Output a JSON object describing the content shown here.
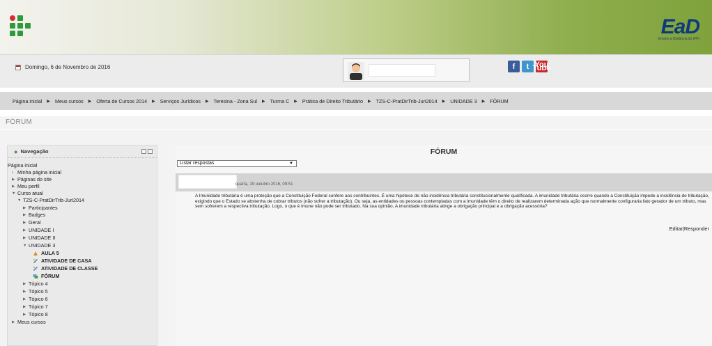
{
  "header": {
    "brand_ead": "EaD",
    "brand_ead_tagline": "Ensino a Distância do IFPI"
  },
  "infobar": {
    "date": "Domingo, 6 de Novembro de 2016"
  },
  "breadcrumb": [
    "Página inicial",
    "Meus cursos",
    "Oferta de Cursos 2014",
    "Serviços Jurídicos",
    "Teresina - Zona Sul",
    "Turma C",
    "Prática de Direito Tributário",
    "TZS-C-PratDirTrib-Juri2014",
    "UNIDADE 3",
    "FÓRUM"
  ],
  "page_heading": "FÓRUM",
  "navigation": {
    "title": "Navegação",
    "items": [
      "Página inicial",
      "Minha página inicial",
      "Páginas do site",
      "Meu perfil",
      "Curso atual",
      "TZS-C-PratDirTrib-Juri2014",
      "Participantes",
      "Badges",
      "Geral",
      "UNIDADE I",
      "UNIDADE II",
      "UNIDADE 3",
      "AULA 5",
      "ATIVIDADE DE CASA",
      "ATIVIDADE DE CLASSE",
      "FÓRUM",
      "Tópico 4",
      "Tópico 5",
      "Tópico 6",
      "Tópico 7",
      "Tópico 8",
      "Meus cursos"
    ]
  },
  "forum": {
    "title": "FÓRUM",
    "display_mode": "Listar respostas",
    "post": {
      "date": "quarta, 19 outubro 2016, 09:51",
      "message": "A Imunidade tributária é uma proteção que a Constituição Federal confere aos contribuintes. É uma hipótese de não incidência tributária constitucionalmente qualificada. A imunidade tributária ocorre quando a Constituição impede a incidência de tributação, exigindo que o Estado se abstenha de cobrar tributos (não sofrer a tributação). Ou seja, as entidades ou pessoas contempladas com a imunidade têm o direito de realizarem determinada ação que normalmente configuraria fato gerador de um tributo, mas sem sofrerem a respectiva tributação. Logo, o que é imune não pode ser tributado. Na sua opinião, A imunidade tributária atinge a obrigação principal e a obrigação acessória?",
      "edit_label": "Editar",
      "action_separator": "|",
      "reply_label": "Responder"
    }
  },
  "social": {
    "facebook_glyph": "f",
    "twitter_glyph": "t",
    "youtube_glyph_top": "You",
    "youtube_glyph_bottom": "Tube"
  },
  "colors": {
    "header_green": "#7fa23c",
    "ifpi_green": "#2f9a3b",
    "ead_blue": "#0d3a7a",
    "ifpi_red": "#d32f2f"
  }
}
